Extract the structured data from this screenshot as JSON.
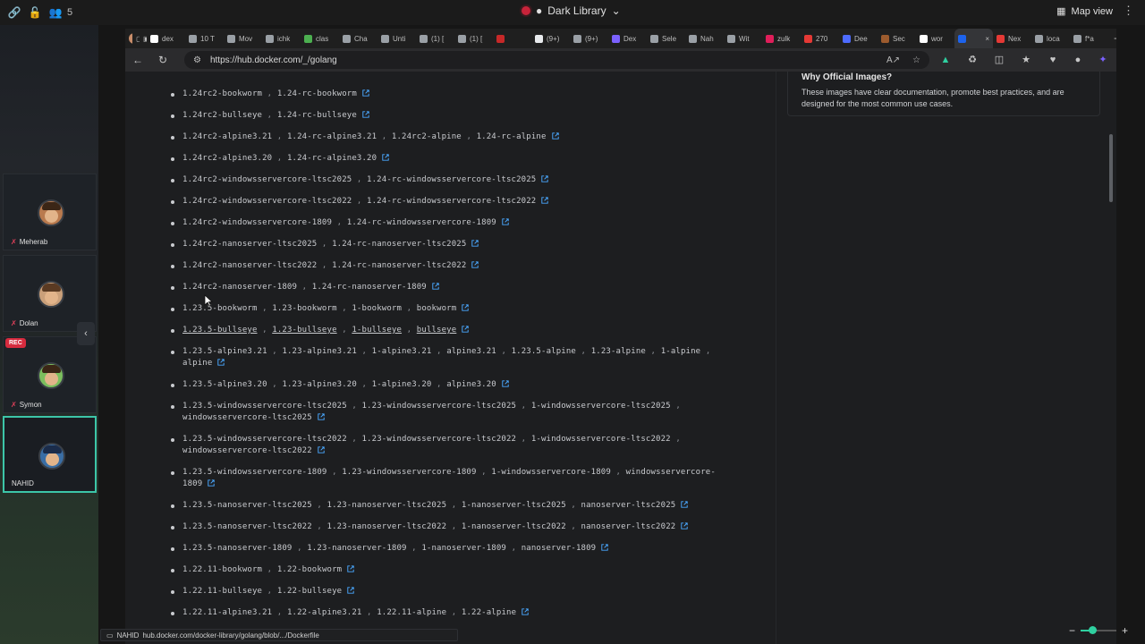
{
  "topbar": {
    "participant_count": "5",
    "session_title": "Dark Library",
    "map_view_label": "Map view"
  },
  "participants": [
    {
      "name": "Meherab"
    },
    {
      "name": "Dolan"
    },
    {
      "name": "Symon"
    },
    {
      "name": "NAHID"
    }
  ],
  "rec_label": "REC",
  "browser": {
    "tabs": [
      {
        "label": "dex",
        "color": "#ffffff"
      },
      {
        "label": "10 T",
        "color": "#9aa0a6"
      },
      {
        "label": "Mov",
        "color": "#9aa0a6"
      },
      {
        "label": "ichk",
        "color": "#9aa0a6"
      },
      {
        "label": "clas",
        "color": "#4caf50"
      },
      {
        "label": "Cha",
        "color": "#9aa0a6"
      },
      {
        "label": "Unti",
        "color": "#9aa0a6"
      },
      {
        "label": "(1) [",
        "color": "#9aa0a6"
      },
      {
        "label": "(1) [",
        "color": "#9aa0a6"
      },
      {
        "label": "",
        "color": "#c62828"
      },
      {
        "label": "(9+)",
        "color": "#e8eaed"
      },
      {
        "label": "(9+)",
        "color": "#9aa0a6"
      },
      {
        "label": "Dex",
        "color": "#7b61ff"
      },
      {
        "label": "Sele",
        "color": "#9aa0a6"
      },
      {
        "label": "Nah",
        "color": "#9aa0a6"
      },
      {
        "label": "Wit",
        "color": "#9aa0a6"
      },
      {
        "label": "zulk",
        "color": "#e01e5a"
      },
      {
        "label": "270",
        "color": "#e53935"
      },
      {
        "label": "Dee",
        "color": "#4d6bfe"
      },
      {
        "label": "Sec",
        "color": "#9c5b2e"
      },
      {
        "label": "wor",
        "color": "#ffffff"
      },
      {
        "label": "",
        "color": "#1d63ed",
        "active": true
      },
      {
        "label": "Nex",
        "color": "#e53935"
      },
      {
        "label": "loca",
        "color": "#9aa0a6"
      },
      {
        "label": "f*a",
        "color": "#9aa0a6"
      }
    ],
    "url": "https://hub.docker.com/_/golang",
    "status_url": "hub.docker.com/docker-library/golang/blob/.../Dockerfile",
    "status_user": "NAHID"
  },
  "sidebar_card": {
    "heading": "Why Official Images?",
    "text": "These images have clear documentation, promote best practices, and are designed for the most common use cases."
  },
  "tag_rows": [
    {
      "tags": [
        "1.24rc2-bookworm",
        "1.24-rc-bookworm"
      ]
    },
    {
      "tags": [
        "1.24rc2-bullseye",
        "1.24-rc-bullseye"
      ]
    },
    {
      "tags": [
        "1.24rc2-alpine3.21",
        "1.24-rc-alpine3.21",
        "1.24rc2-alpine",
        "1.24-rc-alpine"
      ]
    },
    {
      "tags": [
        "1.24rc2-alpine3.20",
        "1.24-rc-alpine3.20"
      ]
    },
    {
      "tags": [
        "1.24rc2-windowsservercore-ltsc2025",
        "1.24-rc-windowsservercore-ltsc2025"
      ]
    },
    {
      "tags": [
        "1.24rc2-windowsservercore-ltsc2022",
        "1.24-rc-windowsservercore-ltsc2022"
      ]
    },
    {
      "tags": [
        "1.24rc2-windowsservercore-1809",
        "1.24-rc-windowsservercore-1809"
      ]
    },
    {
      "tags": [
        "1.24rc2-nanoserver-ltsc2025",
        "1.24-rc-nanoserver-ltsc2025"
      ]
    },
    {
      "tags": [
        "1.24rc2-nanoserver-ltsc2022",
        "1.24-rc-nanoserver-ltsc2022"
      ]
    },
    {
      "tags": [
        "1.24rc2-nanoserver-1809",
        "1.24-rc-nanoserver-1809"
      ]
    },
    {
      "tags": [
        "1.23.5-bookworm",
        "1.23-bookworm",
        "1-bookworm",
        "bookworm"
      ]
    },
    {
      "tags": [
        "1.23.5-bullseye",
        "1.23-bullseye",
        "1-bullseye",
        "bullseye"
      ],
      "hovered": true
    },
    {
      "tags": [
        "1.23.5-alpine3.21",
        "1.23-alpine3.21",
        "1-alpine3.21",
        "alpine3.21",
        "1.23.5-alpine",
        "1.23-alpine",
        "1-alpine",
        "alpine"
      ]
    },
    {
      "tags": [
        "1.23.5-alpine3.20",
        "1.23-alpine3.20",
        "1-alpine3.20",
        "alpine3.20"
      ]
    },
    {
      "tags": [
        "1.23.5-windowsservercore-ltsc2025",
        "1.23-windowsservercore-ltsc2025",
        "1-windowsservercore-ltsc2025",
        "windowsservercore-ltsc2025"
      ]
    },
    {
      "tags": [
        "1.23.5-windowsservercore-ltsc2022",
        "1.23-windowsservercore-ltsc2022",
        "1-windowsservercore-ltsc2022",
        "windowsservercore-ltsc2022"
      ]
    },
    {
      "tags": [
        "1.23.5-windowsservercore-1809",
        "1.23-windowsservercore-1809",
        "1-windowsservercore-1809",
        "windowsservercore-1809"
      ]
    },
    {
      "tags": [
        "1.23.5-nanoserver-ltsc2025",
        "1.23-nanoserver-ltsc2025",
        "1-nanoserver-ltsc2025",
        "nanoserver-ltsc2025"
      ]
    },
    {
      "tags": [
        "1.23.5-nanoserver-ltsc2022",
        "1.23-nanoserver-ltsc2022",
        "1-nanoserver-ltsc2022",
        "nanoserver-ltsc2022"
      ]
    },
    {
      "tags": [
        "1.23.5-nanoserver-1809",
        "1.23-nanoserver-1809",
        "1-nanoserver-1809",
        "nanoserver-1809"
      ]
    },
    {
      "tags": [
        "1.22.11-bookworm",
        "1.22-bookworm"
      ]
    },
    {
      "tags": [
        "1.22.11-bullseye",
        "1.22-bullseye"
      ]
    },
    {
      "tags": [
        "1.22.11-alpine3.21",
        "1.22-alpine3.21",
        "1.22.11-alpine",
        "1.22-alpine"
      ]
    }
  ],
  "colors": {
    "accent": "#3cc6a8",
    "link_icon": "#4aa8ff",
    "rec": "#d62b3e"
  }
}
